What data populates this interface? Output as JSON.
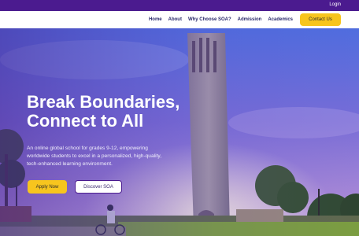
{
  "topbar": {
    "login_label": "Login"
  },
  "nav": {
    "items": [
      {
        "label": "Home"
      },
      {
        "label": "About"
      },
      {
        "label": "Why Choose SOA?"
      },
      {
        "label": "Admission"
      },
      {
        "label": "Academics"
      }
    ],
    "contact_label": "Contact Us"
  },
  "hero": {
    "headline_line1": "Break Boundaries,",
    "headline_line2": "Connect to All",
    "subtext": "An online global school for grades 9-12, empowering worldwide students to excel in a personalized, high-quality, tech-enhanced learning environment.",
    "primary_button": "Apply Now",
    "secondary_button": "Discover SOA"
  },
  "colors": {
    "brand_purple": "#4b1b8f",
    "accent_yellow": "#f7c51e",
    "overlay_purple": "#6a55c8"
  }
}
